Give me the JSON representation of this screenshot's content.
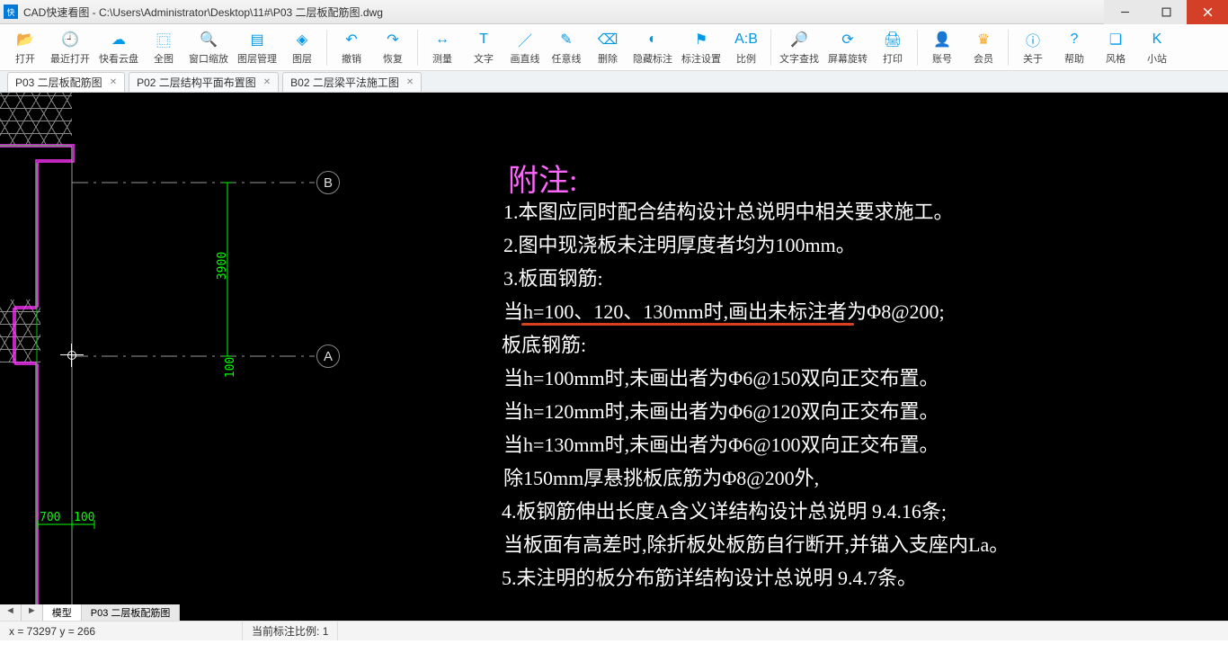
{
  "window": {
    "app": "CAD快速看图",
    "title": "CAD快速看图 - C:\\Users\\Administrator\\Desktop\\11#\\P03 二层板配筋图.dwg"
  },
  "toolbar": [
    {
      "id": "open",
      "label": "打开"
    },
    {
      "id": "recent",
      "label": "最近打开"
    },
    {
      "id": "cloud",
      "label": "快看云盘"
    },
    {
      "id": "fullview",
      "label": "全图"
    },
    {
      "id": "zoomwin",
      "label": "窗口缩放"
    },
    {
      "id": "layermgr",
      "label": "图层管理"
    },
    {
      "id": "layers",
      "label": "图层"
    },
    {
      "id": "undo",
      "label": "撤销"
    },
    {
      "id": "redo",
      "label": "恢复"
    },
    {
      "id": "measure",
      "label": "测量"
    },
    {
      "id": "text",
      "label": "文字"
    },
    {
      "id": "line",
      "label": "画直线"
    },
    {
      "id": "freeline",
      "label": "任意线"
    },
    {
      "id": "delete",
      "label": "删除"
    },
    {
      "id": "hidemk",
      "label": "隐藏标注"
    },
    {
      "id": "mksetting",
      "label": "标注设置"
    },
    {
      "id": "scale",
      "label": "比例"
    },
    {
      "id": "findtext",
      "label": "文字查找"
    },
    {
      "id": "rotate",
      "label": "屏幕旋转"
    },
    {
      "id": "print",
      "label": "打印"
    },
    {
      "id": "account",
      "label": "账号"
    },
    {
      "id": "vip",
      "label": "会员"
    },
    {
      "id": "about",
      "label": "关于"
    },
    {
      "id": "help",
      "label": "帮助"
    },
    {
      "id": "style",
      "label": "风格"
    },
    {
      "id": "mini",
      "label": "小站"
    }
  ],
  "tabs": [
    {
      "label": "P03 二层板配筋图",
      "active": true
    },
    {
      "label": "P02 二层结构平面布置图",
      "active": false
    },
    {
      "label": "B02 二层梁平法施工图",
      "active": false
    }
  ],
  "drawing": {
    "bubbleA": "A",
    "bubbleB": "B",
    "dim3900": "3900",
    "dim100": "100",
    "dim700": "700",
    "dim100b": "100",
    "notes": {
      "heading": "附注:",
      "l1": "1.本图应同时配合结构设计总说明中相关要求施工。",
      "l2": "2.图中现浇板未注明厚度者均为100mm。",
      "l3": "3.板面钢筋:",
      "l3a": "   当h=100、120、130mm时,画出未标注者为Φ8@200;",
      "l3b": "板底钢筋:",
      "l3c": "   当h=100mm时,未画出者为Φ6@150双向正交布置。",
      "l3d": "   当h=120mm时,未画出者为Φ6@120双向正交布置。",
      "l3e": "   当h=130mm时,未画出者为Φ6@100双向正交布置。",
      "l3f": "   除150mm厚悬挑板底筋为Φ8@200外,",
      "l4": "4.板钢筋伸出长度A含义详结构设计总说明 9.4.16条;",
      "l4a": "   当板面有高差时,除折板处板筋自行断开,并锚入支座内La。",
      "l5": "5.未注明的板分布筋详结构设计总说明 9.4.7条。"
    }
  },
  "layout_tabs": [
    {
      "label": "模型",
      "active": true
    },
    {
      "label": "P03 二层板配筋图",
      "active": false
    }
  ],
  "status": {
    "coords": "x = 73297 y = 266",
    "scale_label": "当前标注比例:",
    "scale_value": "1"
  }
}
